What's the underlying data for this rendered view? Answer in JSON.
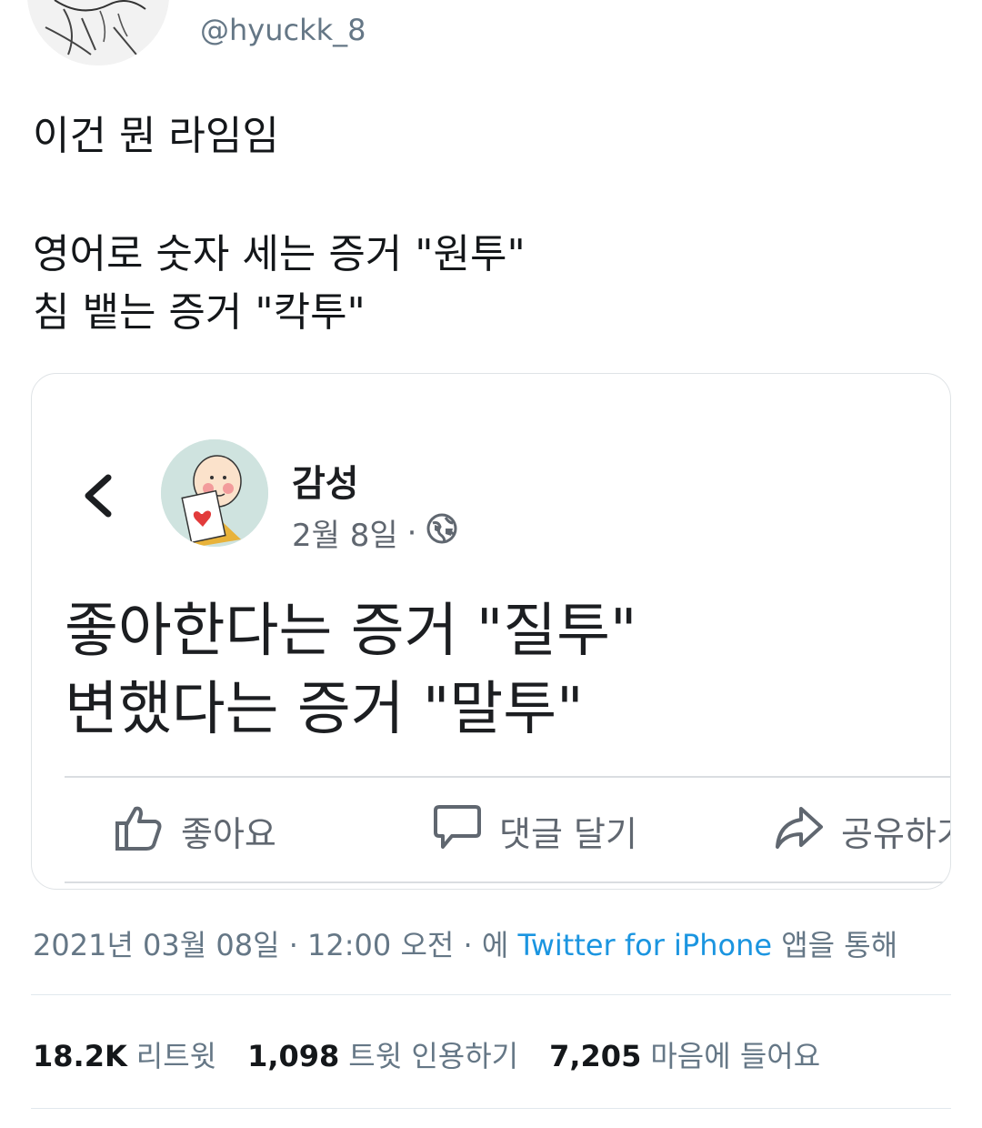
{
  "tweet": {
    "handle": "@hyuckk_8",
    "lines": [
      "이건 뭔 라임임",
      "영어로 숫자 세는 증거 \"원투\"",
      "침 뱉는 증거 \"칵투\""
    ],
    "timestamp_prefix": "2021년 03월 08일 · 12:00 오전 · 에 ",
    "source_app": "Twitter for iPhone",
    "timestamp_suffix": " 앱을 통해"
  },
  "embedded_post": {
    "page_name": "감성",
    "date": "2월 8일",
    "separator": "·",
    "lines": [
      "좋아한다는 증거 \"질투\"",
      "변했다는 증거 \"말투\""
    ],
    "actions": {
      "like": "좋아요",
      "comment": "댓글 달기",
      "share": "공유하기"
    }
  },
  "stats": {
    "retweets_count": "18.2K",
    "retweets_label": "리트윗",
    "quotes_count": "1,098",
    "quotes_label": "트윗 인용하기",
    "likes_count": "7,205",
    "likes_label": "마음에 들어요"
  },
  "icons": [
    "back-chevron-icon",
    "globe-icon",
    "thumbs-up-icon",
    "comment-bubble-icon",
    "share-arrow-icon"
  ],
  "colors": {
    "link": "#1b95e0",
    "muted": "#657786",
    "text": "#14171a"
  }
}
